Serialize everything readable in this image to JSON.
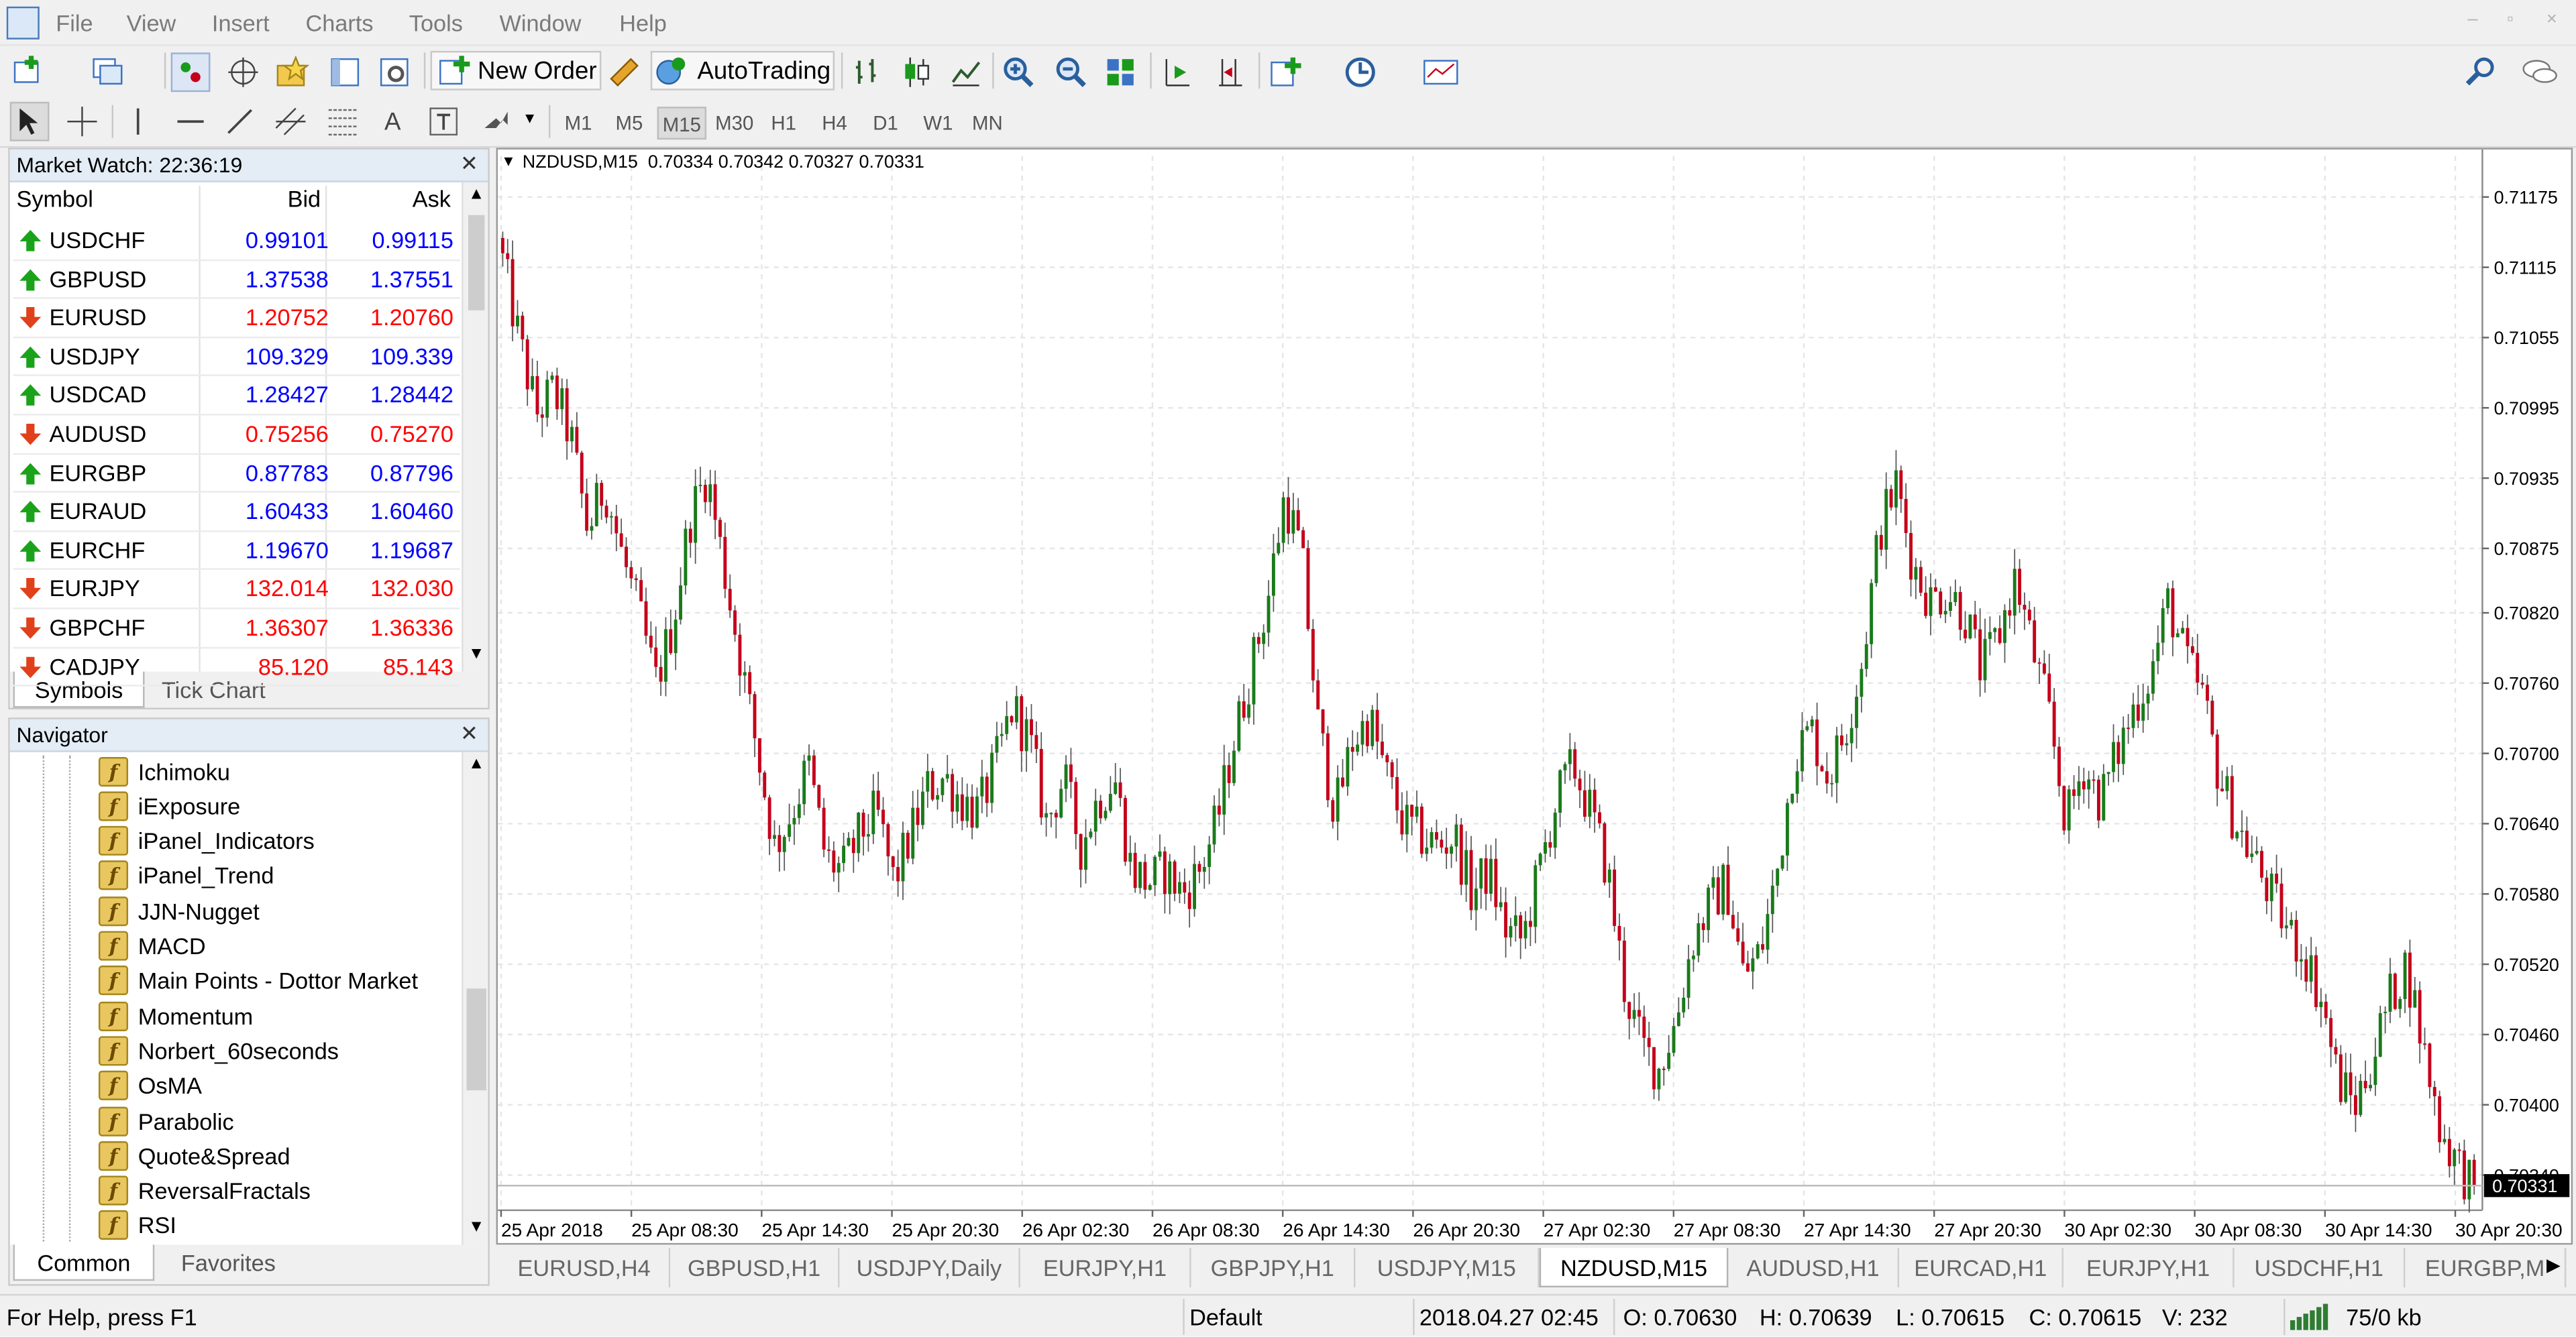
{
  "menu": {
    "items": [
      "File",
      "View",
      "Insert",
      "Charts",
      "Tools",
      "Window",
      "Help"
    ]
  },
  "toolbar": {
    "new_order_label": "New Order",
    "autotrading_label": "AutoTrading"
  },
  "timeframes": [
    "M1",
    "M5",
    "M15",
    "M30",
    "H1",
    "H4",
    "D1",
    "W1",
    "MN"
  ],
  "active_timeframe": "M15",
  "market_watch": {
    "title": "Market Watch: 22:36:19",
    "headers": {
      "symbol": "Symbol",
      "bid": "Bid",
      "ask": "Ask"
    },
    "rows": [
      {
        "symbol": "USDCHF",
        "bid": "0.99101",
        "ask": "0.99115",
        "dir": "up"
      },
      {
        "symbol": "GBPUSD",
        "bid": "1.37538",
        "ask": "1.37551",
        "dir": "up"
      },
      {
        "symbol": "EURUSD",
        "bid": "1.20752",
        "ask": "1.20760",
        "dir": "down"
      },
      {
        "symbol": "USDJPY",
        "bid": "109.329",
        "ask": "109.339",
        "dir": "up"
      },
      {
        "symbol": "USDCAD",
        "bid": "1.28427",
        "ask": "1.28442",
        "dir": "up"
      },
      {
        "symbol": "AUDUSD",
        "bid": "0.75256",
        "ask": "0.75270",
        "dir": "down"
      },
      {
        "symbol": "EURGBP",
        "bid": "0.87783",
        "ask": "0.87796",
        "dir": "up"
      },
      {
        "symbol": "EURAUD",
        "bid": "1.60433",
        "ask": "1.60460",
        "dir": "up"
      },
      {
        "symbol": "EURCHF",
        "bid": "1.19670",
        "ask": "1.19687",
        "dir": "up"
      },
      {
        "symbol": "EURJPY",
        "bid": "132.014",
        "ask": "132.030",
        "dir": "down"
      },
      {
        "symbol": "GBPCHF",
        "bid": "1.36307",
        "ask": "1.36336",
        "dir": "down"
      },
      {
        "symbol": "CADJPY",
        "bid": "85.120",
        "ask": "85.143",
        "dir": "down"
      }
    ],
    "tabs": [
      "Symbols",
      "Tick Chart"
    ],
    "colors": {
      "up": "#0000ff",
      "down": "#ff0000"
    }
  },
  "navigator": {
    "title": "Navigator",
    "items": [
      "Ichimoku",
      "iExposure",
      "iPanel_Indicators",
      "iPanel_Trend",
      "JJN-Nugget",
      "MACD",
      "Main Points - Dottor Market",
      "Momentum",
      "Norbert_60seconds",
      "OsMA",
      "Parabolic",
      "Quote&Spread",
      "ReversalFractals",
      "RSI"
    ],
    "tabs": [
      "Common",
      "Favorites"
    ]
  },
  "chart": {
    "header": "NZDUSD,M15  0.70334 0.70342 0.70327 0.70331",
    "price_labels": [
      "0.71175",
      "0.71115",
      "0.71055",
      "0.70995",
      "0.70935",
      "0.70875",
      "0.70820",
      "0.70760",
      "0.70700",
      "0.70640",
      "0.70580",
      "0.70520",
      "0.70460",
      "0.70400",
      "0.70340"
    ],
    "current_price": "0.70331",
    "time_labels": [
      "25 Apr 2018",
      "25 Apr 08:30",
      "25 Apr 14:30",
      "25 Apr 20:30",
      "26 Apr 02:30",
      "26 Apr 08:30",
      "26 Apr 14:30",
      "26 Apr 20:30",
      "27 Apr 02:30",
      "27 Apr 08:30",
      "27 Apr 14:30",
      "27 Apr 20:30",
      "30 Apr 02:30",
      "30 Apr 08:30",
      "30 Apr 14:30",
      "30 Apr 20:30"
    ],
    "bull_color": "#1a7a1a",
    "bear_color": "#c4001a",
    "tabs": [
      "EURUSD,H4",
      "GBPUSD,H1",
      "USDJPY,Daily",
      "EURJPY,H1",
      "GBPJPY,H1",
      "USDJPY,M15",
      "NZDUSD,M15",
      "AUDUSD,H1",
      "EURCAD,H1",
      "EURJPY,H1",
      "USDCHF,H1",
      "EURGBP,M"
    ],
    "active_tab": "NZDUSD,M15"
  },
  "chart_data": {
    "type": "candlestick",
    "symbol": "NZDUSD,M15",
    "ylim": [
      0.7031,
      0.7121
    ],
    "close_path": [
      0.7112,
      0.7105,
      0.7099,
      0.7101,
      0.7097,
      0.7089,
      0.7093,
      0.7087,
      0.7082,
      0.7076,
      0.7081,
      0.709,
      0.7094,
      0.7086,
      0.7078,
      0.707,
      0.7062,
      0.7065,
      0.7069,
      0.7061,
      0.706,
      0.7063,
      0.7065,
      0.7059,
      0.7063,
      0.7067,
      0.7068,
      0.7066,
      0.7065,
      0.7069,
      0.7074,
      0.7071,
      0.7064,
      0.7068,
      0.7062,
      0.7066,
      0.7068,
      0.706,
      0.7059,
      0.706,
      0.7058,
      0.706,
      0.7064,
      0.7071,
      0.7077,
      0.7083,
      0.7092,
      0.7087,
      0.7072,
      0.7065,
      0.7071,
      0.7073,
      0.7068,
      0.7064,
      0.7063,
      0.7062,
      0.7063,
      0.7058,
      0.706,
      0.7055,
      0.7054,
      0.706,
      0.7066,
      0.7069,
      0.7065,
      0.706,
      0.705,
      0.7045,
      0.7043,
      0.7047,
      0.7054,
      0.7057,
      0.7059,
      0.7051,
      0.7053,
      0.706,
      0.707,
      0.7072,
      0.7068,
      0.7072,
      0.7078,
      0.7089,
      0.7093,
      0.7086,
      0.7083,
      0.7084,
      0.7082,
      0.7077,
      0.708,
      0.7085,
      0.7079,
      0.7073,
      0.7064,
      0.7069,
      0.7066,
      0.707,
      0.7074,
      0.7077,
      0.7083,
      0.7078,
      0.7075,
      0.7068,
      0.7064,
      0.7061,
      0.7058,
      0.7055,
      0.7053,
      0.7049,
      0.7042,
      0.704,
      0.7044,
      0.7049,
      0.7052,
      0.7045,
      0.7038,
      0.7035,
      0.7033
    ]
  }
}
